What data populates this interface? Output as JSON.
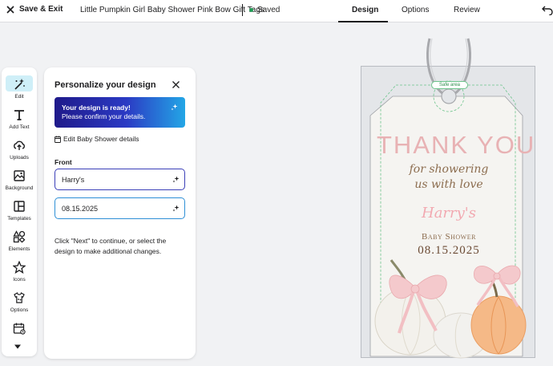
{
  "topbar": {
    "save_exit_label": "Save & Exit",
    "doc_title": "Little Pumpkin Girl Baby Shower Pink Bow Gift Tags",
    "saved_label": "Saved",
    "tabs": [
      {
        "label": "Design",
        "active": true
      },
      {
        "label": "Options",
        "active": false
      },
      {
        "label": "Review",
        "active": false
      }
    ]
  },
  "toolbar": {
    "items": [
      {
        "label": "Edit",
        "icon": "wand-icon",
        "active": true
      },
      {
        "label": "Add Text",
        "icon": "text-icon"
      },
      {
        "label": "Uploads",
        "icon": "cloud-upload-icon"
      },
      {
        "label": "Background",
        "icon": "image-icon"
      },
      {
        "label": "Templates",
        "icon": "templates-icon"
      },
      {
        "label": "Elements",
        "icon": "elements-icon"
      },
      {
        "label": "Icons",
        "icon": "star-icon"
      },
      {
        "label": "Options",
        "icon": "shirt-icon"
      },
      {
        "label": "",
        "icon": "calendar-icon"
      }
    ]
  },
  "panel": {
    "title": "Personalize your design",
    "ready_line1": "Your design is ready!",
    "ready_line2": "Please confirm your details.",
    "edit_link": "Edit Baby Shower details",
    "section_label": "Front",
    "fields": [
      {
        "value": "Harry's"
      },
      {
        "value": "08.15.2025"
      }
    ],
    "help_text": "Click \"Next\" to continue, or select the design to make additional changes."
  },
  "canvas": {
    "safe_area_label": "Safe area",
    "tag": {
      "line_thank": "THANK YOU",
      "line_script1": "for showering",
      "line_script2": "us with love",
      "name": "Harry's",
      "event": "Baby Shower",
      "date": "08.15.2025"
    },
    "colors": {
      "thank": "#e8b2b4",
      "script": "#8c6d4f",
      "name": "#f2a9b1",
      "safe_line": "#6cc48b"
    }
  }
}
